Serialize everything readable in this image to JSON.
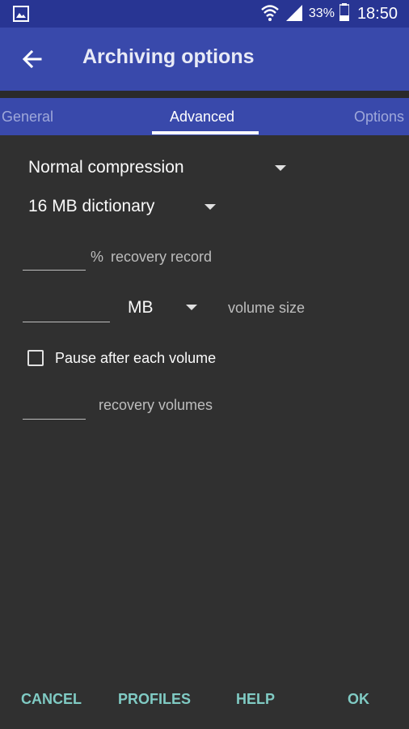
{
  "status_bar": {
    "icons": [
      "image-icon",
      "wifi-icon",
      "signal-icon",
      "battery-icon"
    ],
    "battery": "33%",
    "time": "18:50"
  },
  "app_bar": {
    "title": "Archiving options",
    "back_icon": "arrow-left-icon"
  },
  "tabs": [
    {
      "label": "General",
      "active": false
    },
    {
      "label": "Advanced",
      "active": true
    },
    {
      "label": "Options",
      "active": false
    }
  ],
  "form": {
    "compression": "Normal compression",
    "dictionary": "16 MB dictionary",
    "recovery_record": {
      "value": "",
      "unit": "%",
      "label": "recovery record"
    },
    "volume": {
      "value": "",
      "unit": "MB",
      "label": "volume size"
    },
    "pause_checkbox": {
      "label": "Pause after each volume",
      "checked": false
    },
    "recovery_volumes": {
      "value": "",
      "label": "recovery volumes"
    }
  },
  "actions": {
    "cancel": "CANCEL",
    "profiles": "PROFILES",
    "help": "HELP",
    "ok": "OK"
  },
  "colors": {
    "status_bar": "#283593",
    "app_bar": "#3949ab",
    "background": "#303030",
    "accent": "#80cbc4"
  }
}
